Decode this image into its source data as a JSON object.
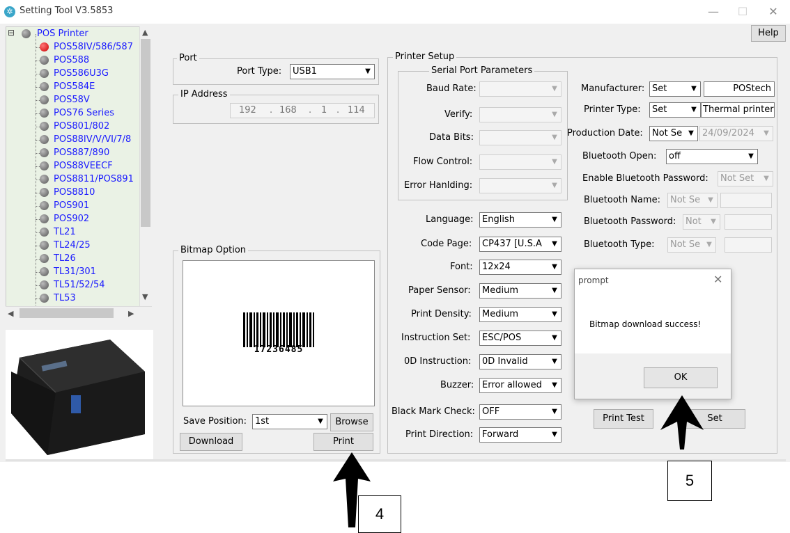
{
  "window": {
    "title": "Setting Tool V3.5853",
    "minimize": "—",
    "maximize": "☐",
    "close": "✕"
  },
  "help_label": "Help",
  "tree": {
    "items": [
      {
        "label": "POS Printer",
        "status": "root"
      },
      {
        "label": "POS58IV/586/587",
        "status": "active"
      },
      {
        "label": "POS588"
      },
      {
        "label": "POS586U3G"
      },
      {
        "label": "POS584E"
      },
      {
        "label": "POS58V"
      },
      {
        "label": "POS76 Series"
      },
      {
        "label": "POS801/802"
      },
      {
        "label": "POS88IV/V/VI/7/8"
      },
      {
        "label": "POS887/890"
      },
      {
        "label": "POS88VEECF"
      },
      {
        "label": "POS8811/POS891"
      },
      {
        "label": "POS8810"
      },
      {
        "label": "POS901"
      },
      {
        "label": "POS902"
      },
      {
        "label": "TL21"
      },
      {
        "label": "TL24/25"
      },
      {
        "label": "TL26"
      },
      {
        "label": "TL31/301"
      },
      {
        "label": "TL51/52/54"
      },
      {
        "label": "TL53"
      }
    ],
    "expander": "⊟"
  },
  "port": {
    "group_title": "Port",
    "port_type_label": "Port Type:",
    "port_type_value": "USB1"
  },
  "ip": {
    "group_title": "IP Address",
    "octets": [
      "192",
      "168",
      "1",
      "114"
    ]
  },
  "bitmap": {
    "group_title": "Bitmap Option",
    "barcode_number": "17236485",
    "save_position_label": "Save Position:",
    "save_position_value": "1st",
    "browse_label": "Browse",
    "download_label": "Download",
    "print_label": "Print"
  },
  "printer_setup": {
    "group_title": "Printer Setup",
    "serial_title": "Serial Port Parameters",
    "baud_rate_label": "Baud Rate:",
    "verify_label": "Verify:",
    "data_bits_label": "Data Bits:",
    "flow_control_label": "Flow Control:",
    "error_handling_label": "Error Hanlding:",
    "language_label": "Language:",
    "language_value": "English",
    "code_page_label": "Code Page:",
    "code_page_value": "CP437 [U.S.A",
    "font_label": "Font:",
    "font_value": "12x24",
    "paper_sensor_label": "Paper Sensor:",
    "paper_sensor_value": "Medium",
    "print_density_label": "Print Density:",
    "print_density_value": "Medium",
    "instruction_set_label": "Instruction Set:",
    "instruction_set_value": "ESC/POS",
    "od_instruction_label": "0D Instruction:",
    "od_instruction_value": "0D Invalid",
    "buzzer_label": "Buzzer:",
    "buzzer_value": "Error allowed",
    "black_mark_label": "Black Mark Check:",
    "black_mark_value": "OFF",
    "print_direction_label": "Print Direction:",
    "print_direction_value": "Forward",
    "manufacturer_label": "Manufacturer:",
    "manufacturer_mode": "Set",
    "manufacturer_value": "POStech",
    "printer_type_label": "Printer Type:",
    "printer_type_mode": "Set",
    "printer_type_value": "Thermal printer",
    "production_date_label": "Production Date:",
    "production_date_mode": "Not Se",
    "production_date_value": "24/09/2024",
    "bt_open_label": "Bluetooth Open:",
    "bt_open_value": "off",
    "bt_enable_pwd_label": "Enable Bluetooth Password:",
    "bt_enable_pwd_value": "Not Set",
    "bt_name_label": "Bluetooth Name:",
    "bt_name_mode": "Not Se",
    "bt_password_label": "Bluetooth Password:",
    "bt_password_mode": "Not",
    "bt_type_label": "Bluetooth Type:",
    "bt_type_mode": "Not Se",
    "print_test_label": "Print Test",
    "set_label": "Set"
  },
  "dialog": {
    "title": "prompt",
    "message": "Bitmap download success!",
    "ok_label": "OK",
    "close": "✕"
  },
  "callouts": {
    "four": "4",
    "five": "5"
  }
}
